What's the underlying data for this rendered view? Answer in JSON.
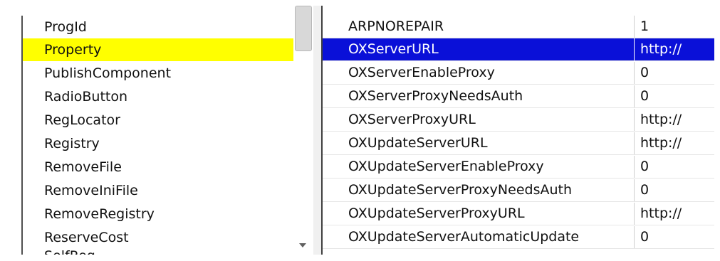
{
  "colors": {
    "selected_table": "#ffff00",
    "selected_property": "#0a10d8"
  },
  "tables": {
    "items": [
      {
        "label": "ProgId"
      },
      {
        "label": "Property"
      },
      {
        "label": "PublishComponent"
      },
      {
        "label": "RadioButton"
      },
      {
        "label": "RegLocator"
      },
      {
        "label": "Registry"
      },
      {
        "label": "RemoveFile"
      },
      {
        "label": "RemoveIniFile"
      },
      {
        "label": "RemoveRegistry"
      },
      {
        "label": "ReserveCost"
      },
      {
        "label": "SelfReg"
      }
    ],
    "selected_index": 1
  },
  "properties": {
    "rows": [
      {
        "name": "ARPNOREPAIR",
        "value": "1"
      },
      {
        "name": "OXServerURL",
        "value": "http://"
      },
      {
        "name": "OXServerEnableProxy",
        "value": "0"
      },
      {
        "name": "OXServerProxyNeedsAuth",
        "value": "0"
      },
      {
        "name": "OXServerProxyURL",
        "value": "http://"
      },
      {
        "name": "OXUpdateServerURL",
        "value": "http://"
      },
      {
        "name": "OXUpdateServerEnableProxy",
        "value": "0"
      },
      {
        "name": "OXUpdateServerProxyNeedsAuth",
        "value": "0"
      },
      {
        "name": "OXUpdateServerProxyURL",
        "value": "http://"
      },
      {
        "name": "OXUpdateServerAutomaticUpdate",
        "value": "0"
      }
    ],
    "selected_index": 1
  }
}
